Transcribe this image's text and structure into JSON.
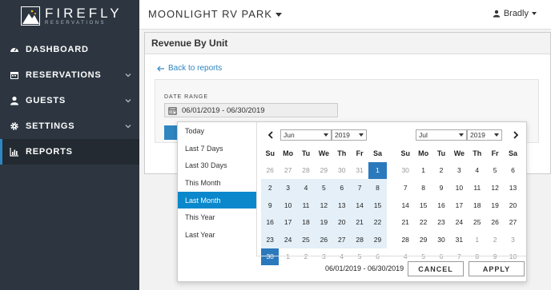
{
  "brand": {
    "name": "FIREFLY",
    "sub": "RESERVATIONS"
  },
  "sidebar": {
    "items": [
      {
        "label": "DASHBOARD",
        "icon": "dashboard-icon"
      },
      {
        "label": "RESERVATIONS",
        "icon": "calendar-icon"
      },
      {
        "label": "GUESTS",
        "icon": "user-icon"
      },
      {
        "label": "SETTINGS",
        "icon": "gear-icon"
      },
      {
        "label": "REPORTS",
        "icon": "bar-chart-icon"
      }
    ]
  },
  "header": {
    "park": "MOONLIGHT RV PARK",
    "user": "Bradly"
  },
  "panel": {
    "title": "Revenue By Unit",
    "back": "Back to reports",
    "date_label": "DATE RANGE",
    "date_value": "06/01/2019 - 06/30/2019"
  },
  "picker": {
    "ranges": [
      "Today",
      "Last 7 Days",
      "Last 30 Days",
      "This Month",
      "Last Month",
      "This Year",
      "Last Year"
    ],
    "active_range": "Last Month",
    "weekdays": [
      "Su",
      "Mo",
      "Tu",
      "We",
      "Th",
      "Fr",
      "Sa"
    ],
    "left": {
      "month": "Jun",
      "year": "2019",
      "days": [
        "26",
        "27",
        "28",
        "29",
        "30",
        "31",
        "1",
        "2",
        "3",
        "4",
        "5",
        "6",
        "7",
        "8",
        "9",
        "10",
        "11",
        "12",
        "13",
        "14",
        "15",
        "16",
        "17",
        "18",
        "19",
        "20",
        "21",
        "22",
        "23",
        "24",
        "25",
        "26",
        "27",
        "28",
        "29",
        "30",
        "1",
        "2",
        "3",
        "4",
        "5",
        "6"
      ]
    },
    "right": {
      "month": "Jul",
      "year": "2019",
      "days": [
        "30",
        "1",
        "2",
        "3",
        "4",
        "5",
        "6",
        "7",
        "8",
        "9",
        "10",
        "11",
        "12",
        "13",
        "14",
        "15",
        "16",
        "17",
        "18",
        "19",
        "20",
        "21",
        "22",
        "23",
        "24",
        "25",
        "26",
        "27",
        "28",
        "29",
        "30",
        "31",
        "1",
        "2",
        "3",
        "4",
        "5",
        "6",
        "7",
        "8",
        "9",
        "10"
      ]
    },
    "footer_range": "06/01/2019 - 06/30/2019",
    "cancel": "CANCEL",
    "apply": "APPLY"
  },
  "colors": {
    "sidebar": "#2d3640",
    "accent": "#2e86c1",
    "range_active": "#0b88cc",
    "selected_day": "#2b79bd",
    "in_range": "#e4eff7"
  }
}
